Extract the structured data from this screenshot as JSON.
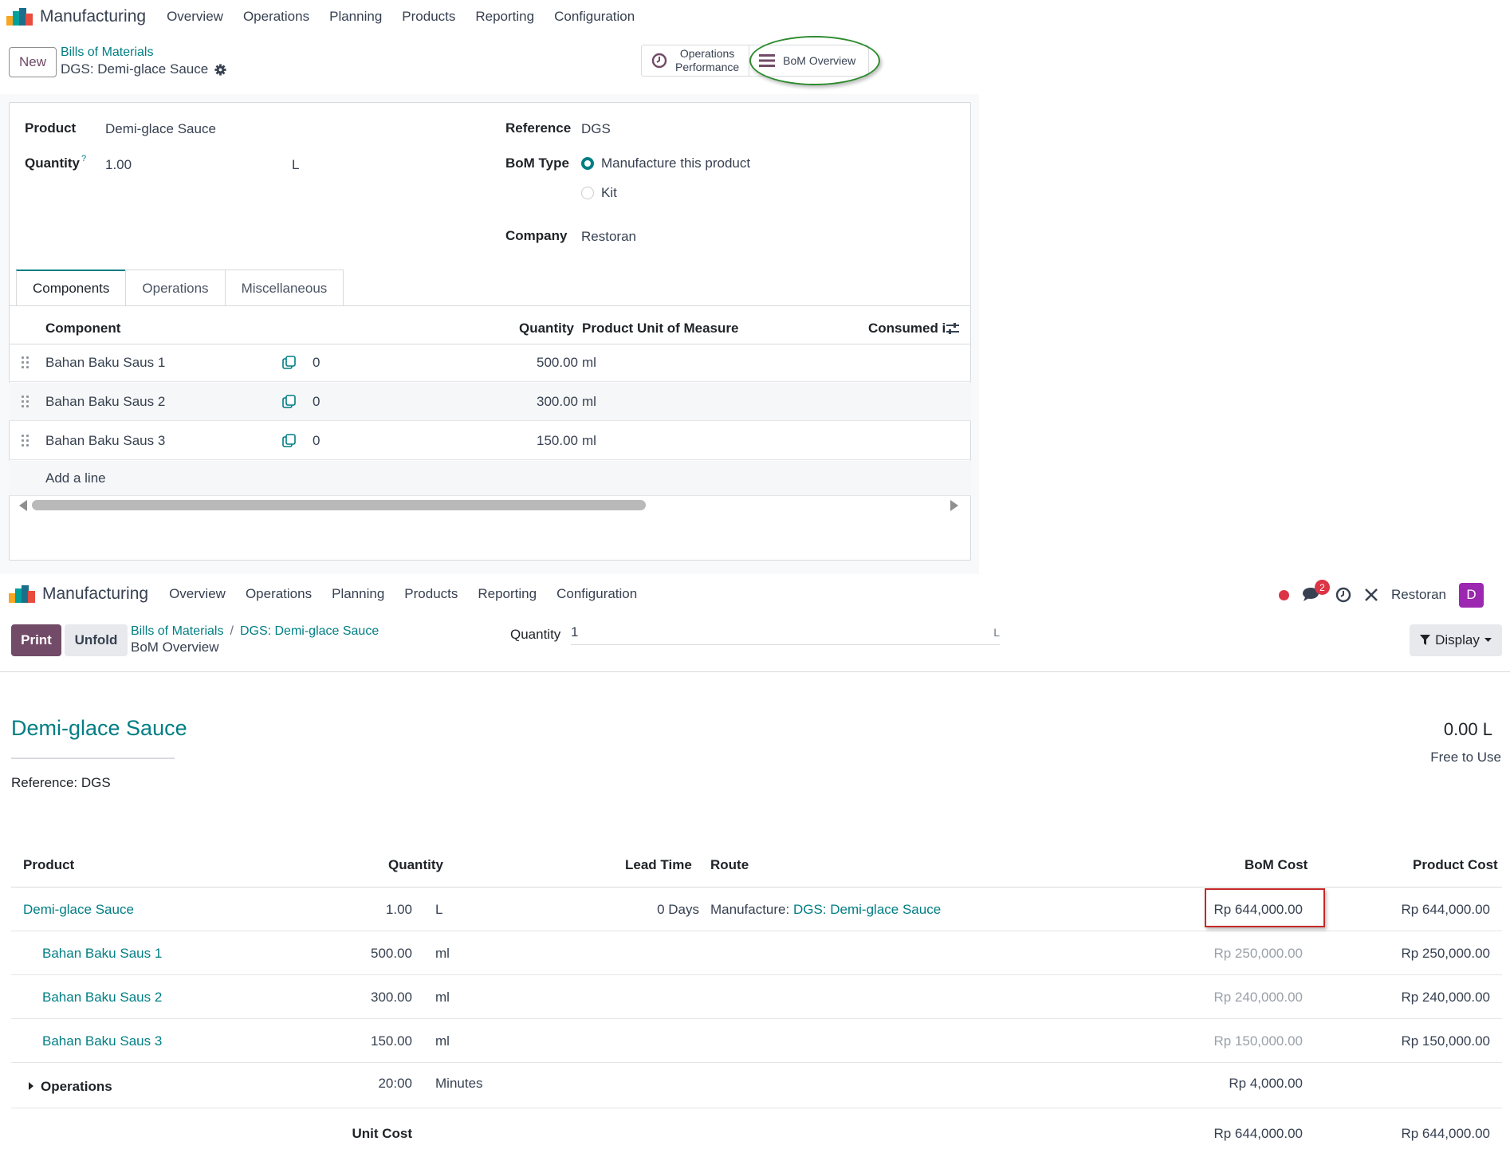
{
  "top": {
    "app_name": "Manufacturing",
    "menu": [
      "Overview",
      "Operations",
      "Planning",
      "Products",
      "Reporting",
      "Configuration"
    ],
    "new_label": "New",
    "breadcrumb_parent": "Bills of Materials",
    "breadcrumb_current": "DGS: Demi-glace Sauce",
    "smart_buttons": {
      "operations_performance_line1": "Operations",
      "operations_performance_line2": "Performance",
      "bom_overview": "BoM Overview"
    },
    "form": {
      "product_label": "Product",
      "product_value": "Demi-glace Sauce",
      "quantity_label": "Quantity",
      "quantity_help": "?",
      "quantity_value": "1.00",
      "quantity_uom": "L",
      "reference_label": "Reference",
      "reference_value": "DGS",
      "bom_type_label": "BoM Type",
      "bom_type_options": [
        "Manufacture this product",
        "Kit"
      ],
      "bom_type_selected": "Manufacture this product",
      "company_label": "Company",
      "company_value": "Restoran"
    },
    "tabs": [
      "Components",
      "Operations",
      "Miscellaneous"
    ],
    "active_tab": "Components",
    "components_table": {
      "headers": {
        "component": "Component",
        "quantity": "Quantity",
        "uom": "Product Unit of Measure",
        "consumed": "Consumed i"
      },
      "rows": [
        {
          "component": "Bahan Baku Saus 1",
          "count": "0",
          "quantity": "500.00",
          "uom": "ml"
        },
        {
          "component": "Bahan Baku Saus 2",
          "count": "0",
          "quantity": "300.00",
          "uom": "ml"
        },
        {
          "component": "Bahan Baku Saus 3",
          "count": "0",
          "quantity": "150.00",
          "uom": "ml"
        }
      ],
      "add_line": "Add a line"
    }
  },
  "bottom": {
    "app_name": "Manufacturing",
    "menu": [
      "Overview",
      "Operations",
      "Planning",
      "Products",
      "Reporting",
      "Configuration"
    ],
    "messages_badge": "2",
    "company": "Restoran",
    "avatar_letter": "D",
    "print_label": "Print",
    "unfold_label": "Unfold",
    "breadcrumb_parent": "Bills of Materials",
    "breadcrumb_separator": "/",
    "breadcrumb_middle": "DGS: Demi-glace Sauce",
    "breadcrumb_current": "BoM Overview",
    "quantity_label": "Quantity",
    "quantity_value": "1",
    "quantity_uom": "L",
    "display_label": "Display",
    "product_title": "Demi-glace Sauce",
    "reference_line": "Reference: DGS",
    "on_hand": "0.00 L",
    "free_to_use": "Free to Use",
    "table": {
      "headers": {
        "product": "Product",
        "quantity": "Quantity",
        "lead_time": "Lead Time",
        "route": "Route",
        "bom_cost": "BoM Cost",
        "product_cost": "Product Cost"
      },
      "main_row": {
        "product": "Demi-glace Sauce",
        "quantity": "1.00",
        "uom": "L",
        "lead_time": "0 Days",
        "route_prefix": "Manufacture:",
        "route_link": "DGS: Demi-glace Sauce",
        "bom_cost": "Rp 644,000.00",
        "product_cost": "Rp 644,000.00"
      },
      "component_rows": [
        {
          "product": "Bahan Baku Saus 1",
          "quantity": "500.00",
          "uom": "ml",
          "bom_cost": "Rp 250,000.00",
          "product_cost": "Rp 250,000.00"
        },
        {
          "product": "Bahan Baku Saus 2",
          "quantity": "300.00",
          "uom": "ml",
          "bom_cost": "Rp 240,000.00",
          "product_cost": "Rp 240,000.00"
        },
        {
          "product": "Bahan Baku Saus 3",
          "quantity": "150.00",
          "uom": "ml",
          "bom_cost": "Rp 150,000.00",
          "product_cost": "Rp 150,000.00"
        }
      ],
      "operations_row": {
        "label": "Operations",
        "quantity": "20:00",
        "uom": "Minutes",
        "bom_cost": "Rp 4,000.00"
      },
      "unit_cost_row": {
        "label": "Unit Cost",
        "bom_cost": "Rp 644,000.00",
        "product_cost": "Rp 644,000.00"
      }
    }
  },
  "colors": {
    "accent_teal": "#017e84",
    "brand_purple": "#714b67",
    "highlight_red": "#c62828",
    "highlight_green": "#2e8b2e"
  }
}
